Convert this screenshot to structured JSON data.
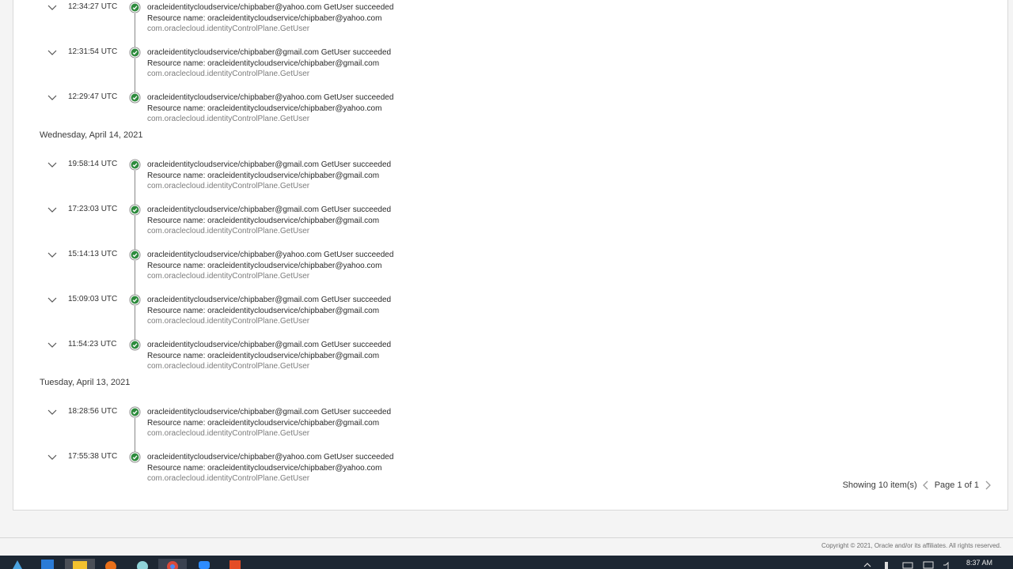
{
  "groups": [
    {
      "date": "",
      "events": [
        {
          "time": "12:34:27 UTC",
          "message": "oracleidentitycloudservice/chipbaber@yahoo.com GetUser succeeded",
          "resource": "Resource name: oracleidentitycloudservice/chipbaber@yahoo.com",
          "source": "com.oraclecloud.identityControlPlane.GetUser"
        },
        {
          "time": "12:31:54 UTC",
          "message": "oracleidentitycloudservice/chipbaber@gmail.com GetUser succeeded",
          "resource": "Resource name: oracleidentitycloudservice/chipbaber@gmail.com",
          "source": "com.oraclecloud.identityControlPlane.GetUser"
        },
        {
          "time": "12:29:47 UTC",
          "message": "oracleidentitycloudservice/chipbaber@yahoo.com GetUser succeeded",
          "resource": "Resource name: oracleidentitycloudservice/chipbaber@yahoo.com",
          "source": "com.oraclecloud.identityControlPlane.GetUser"
        }
      ]
    },
    {
      "date": "Wednesday, April 14, 2021",
      "events": [
        {
          "time": "19:58:14 UTC",
          "message": "oracleidentitycloudservice/chipbaber@gmail.com GetUser succeeded",
          "resource": "Resource name: oracleidentitycloudservice/chipbaber@gmail.com",
          "source": "com.oraclecloud.identityControlPlane.GetUser"
        },
        {
          "time": "17:23:03 UTC",
          "message": "oracleidentitycloudservice/chipbaber@gmail.com GetUser succeeded",
          "resource": "Resource name: oracleidentitycloudservice/chipbaber@gmail.com",
          "source": "com.oraclecloud.identityControlPlane.GetUser"
        },
        {
          "time": "15:14:13 UTC",
          "message": "oracleidentitycloudservice/chipbaber@yahoo.com GetUser succeeded",
          "resource": "Resource name: oracleidentitycloudservice/chipbaber@yahoo.com",
          "source": "com.oraclecloud.identityControlPlane.GetUser"
        },
        {
          "time": "15:09:03 UTC",
          "message": "oracleidentitycloudservice/chipbaber@gmail.com GetUser succeeded",
          "resource": "Resource name: oracleidentitycloudservice/chipbaber@gmail.com",
          "source": "com.oraclecloud.identityControlPlane.GetUser"
        },
        {
          "time": "11:54:23 UTC",
          "message": "oracleidentitycloudservice/chipbaber@gmail.com GetUser succeeded",
          "resource": "Resource name: oracleidentitycloudservice/chipbaber@gmail.com",
          "source": "com.oraclecloud.identityControlPlane.GetUser"
        }
      ]
    },
    {
      "date": "Tuesday, April 13, 2021",
      "events": [
        {
          "time": "18:28:56 UTC",
          "message": "oracleidentitycloudservice/chipbaber@gmail.com GetUser succeeded",
          "resource": "Resource name: oracleidentitycloudservice/chipbaber@gmail.com",
          "source": "com.oraclecloud.identityControlPlane.GetUser"
        },
        {
          "time": "17:55:38 UTC",
          "message": "oracleidentitycloudservice/chipbaber@yahoo.com GetUser succeeded",
          "resource": "Resource name: oracleidentitycloudservice/chipbaber@yahoo.com",
          "source": "com.oraclecloud.identityControlPlane.GetUser"
        }
      ]
    }
  ],
  "pager": {
    "showing": "Showing 10 item(s)",
    "page": "Page 1 of 1"
  },
  "footer": {
    "copyright": "Copyright © 2021, Oracle and/or its affiliates. All rights reserved."
  },
  "taskbar": {
    "clock": "8:37 AM",
    "apps": [
      "vs-code-icon",
      "folder-icon",
      "firefox-icon",
      "app-icon",
      "chrome-icon",
      "zoom-icon",
      "html5-icon"
    ]
  },
  "colors": {
    "success": "#2e8b3d",
    "timeline": "#8a8a8a",
    "taskbar": "#1d2733"
  }
}
